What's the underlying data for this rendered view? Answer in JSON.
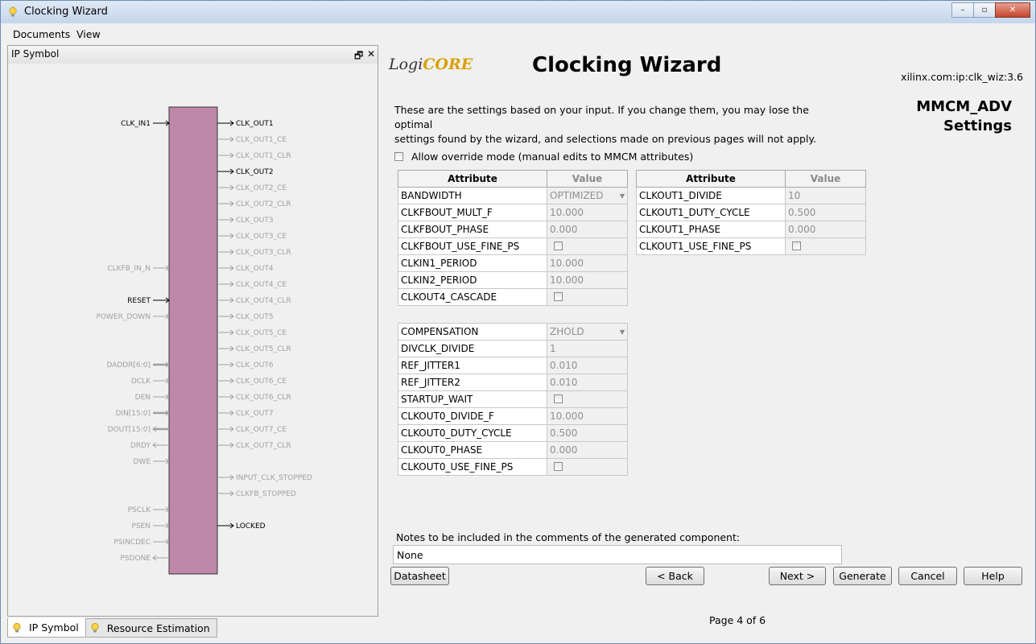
{
  "window": {
    "title": "Clocking Wizard",
    "min": "–",
    "restore": "▫",
    "close": "✕"
  },
  "menu": [
    "Documents",
    "View"
  ],
  "left_panel": {
    "title": "IP Symbol",
    "float_icon": "🗗",
    "close_icon": "✕"
  },
  "bottom_tabs": [
    "IP Symbol",
    "Resource Estimation"
  ],
  "header": {
    "logo_a": "Logi",
    "logo_b": "CORE",
    "title": "Clocking Wizard",
    "ip": "xilinx.com:ip:clk_wiz:3.6",
    "settings_line1": "MMCM_ADV",
    "settings_line2": "Settings"
  },
  "description_line1": "These are the settings based on your input.  If you change them, you may lose the optimal",
  "description_line2": "settings found by the wizard, and selections made on previous pages will not apply.",
  "override_label": "Allow override mode (manual edits to MMCM attributes)",
  "table_headers": {
    "attribute": "Attribute",
    "value": "Value"
  },
  "table_left_a": [
    {
      "attr": "BANDWIDTH",
      "value": "OPTIMIZED",
      "kind": "dropdown"
    },
    {
      "attr": "CLKFBOUT_MULT_F",
      "value": "10.000",
      "kind": "text"
    },
    {
      "attr": "CLKFBOUT_PHASE",
      "value": "0.000",
      "kind": "text"
    },
    {
      "attr": "CLKFBOUT_USE_FINE_PS",
      "value": "",
      "kind": "checkbox"
    },
    {
      "attr": "CLKIN1_PERIOD",
      "value": "10.000",
      "kind": "text"
    },
    {
      "attr": "CLKIN2_PERIOD",
      "value": "10.000",
      "kind": "text"
    },
    {
      "attr": "CLKOUT4_CASCADE",
      "value": "",
      "kind": "checkbox"
    }
  ],
  "table_left_b": [
    {
      "attr": "COMPENSATION",
      "value": "ZHOLD",
      "kind": "dropdown"
    },
    {
      "attr": "DIVCLK_DIVIDE",
      "value": "1",
      "kind": "text"
    },
    {
      "attr": "REF_JITTER1",
      "value": "0.010",
      "kind": "text"
    },
    {
      "attr": "REF_JITTER2",
      "value": "0.010",
      "kind": "text"
    },
    {
      "attr": "STARTUP_WAIT",
      "value": "",
      "kind": "checkbox"
    },
    {
      "attr": "CLKOUT0_DIVIDE_F",
      "value": "10.000",
      "kind": "text"
    },
    {
      "attr": "CLKOUT0_DUTY_CYCLE",
      "value": "0.500",
      "kind": "text"
    },
    {
      "attr": "CLKOUT0_PHASE",
      "value": "0.000",
      "kind": "text"
    },
    {
      "attr": "CLKOUT0_USE_FINE_PS",
      "value": "",
      "kind": "checkbox"
    }
  ],
  "table_right": [
    {
      "attr": "CLKOUT1_DIVIDE",
      "value": "10",
      "kind": "text"
    },
    {
      "attr": "CLKOUT1_DUTY_CYCLE",
      "value": "0.500",
      "kind": "text"
    },
    {
      "attr": "CLKOUT1_PHASE",
      "value": "0.000",
      "kind": "text"
    },
    {
      "attr": "CLKOUT1_USE_FINE_PS",
      "value": "",
      "kind": "checkbox"
    }
  ],
  "notes_label": "Notes to be included in the comments of the generated component:",
  "notes_value": "None",
  "buttons": {
    "datasheet": "Datasheet",
    "back": "< Back",
    "page": "Page 4 of 6",
    "next": "Next >",
    "generate": "Generate",
    "cancel": "Cancel",
    "help": "Help"
  },
  "symbol": {
    "colors": {
      "body": "#bf88a8",
      "active": "#000000",
      "inactive": "#a0a0a0"
    },
    "left_pins": [
      {
        "name": "CLK_IN1",
        "active": true
      },
      {
        "name": "CLKFB_IN_N",
        "active": false
      },
      {
        "name": "RESET",
        "active": true
      },
      {
        "name": "POWER_DOWN",
        "active": false
      },
      {
        "name": "DADDR[6:0]",
        "active": false
      },
      {
        "name": "DCLK",
        "active": false
      },
      {
        "name": "DEN",
        "active": false
      },
      {
        "name": "DIN[15:0]",
        "active": false
      },
      {
        "name": "DOUT[15:0]",
        "active": false
      },
      {
        "name": "DRDY",
        "active": false
      },
      {
        "name": "DWE",
        "active": false
      },
      {
        "name": "PSCLK",
        "active": false
      },
      {
        "name": "PSEN",
        "active": false
      },
      {
        "name": "PSINCDEC",
        "active": false
      },
      {
        "name": "PSDONE",
        "active": false
      }
    ],
    "right_pins": [
      {
        "name": "CLK_OUT1",
        "active": true
      },
      {
        "name": "CLK_OUT1_CE",
        "active": false
      },
      {
        "name": "CLK_OUT1_CLR",
        "active": false
      },
      {
        "name": "CLK_OUT2",
        "active": true
      },
      {
        "name": "CLK_OUT2_CE",
        "active": false
      },
      {
        "name": "CLK_OUT2_CLR",
        "active": false
      },
      {
        "name": "CLK_OUT3",
        "active": false
      },
      {
        "name": "CLK_OUT3_CE",
        "active": false
      },
      {
        "name": "CLK_OUT3_CLR",
        "active": false
      },
      {
        "name": "CLK_OUT4",
        "active": false
      },
      {
        "name": "CLK_OUT4_CE",
        "active": false
      },
      {
        "name": "CLK_OUT4_CLR",
        "active": false
      },
      {
        "name": "CLK_OUT5",
        "active": false
      },
      {
        "name": "CLK_OUT5_CE",
        "active": false
      },
      {
        "name": "CLK_OUT5_CLR",
        "active": false
      },
      {
        "name": "CLK_OUT6",
        "active": false
      },
      {
        "name": "CLK_OUT6_CE",
        "active": false
      },
      {
        "name": "CLK_OUT6_CLR",
        "active": false
      },
      {
        "name": "CLK_OUT7",
        "active": false
      },
      {
        "name": "CLK_OUT7_CE",
        "active": false
      },
      {
        "name": "CLK_OUT7_CLR",
        "active": false
      },
      {
        "name": "INPUT_CLK_STOPPED",
        "active": false
      },
      {
        "name": "CLKFB_STOPPED",
        "active": false
      },
      {
        "name": "LOCKED",
        "active": true
      }
    ]
  }
}
